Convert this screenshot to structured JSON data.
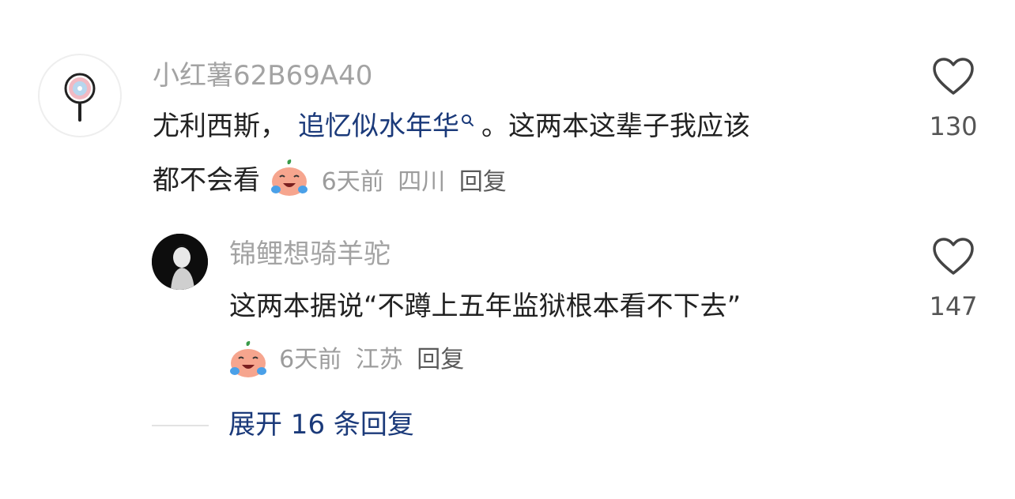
{
  "comment": {
    "username": "小红薯62B69A40",
    "text_prefix": "尤利西斯，",
    "link_text": "追忆似水年华",
    "text_suffix": "。这两本这辈子我应该",
    "text_line2": "都不会看",
    "time": "6天前",
    "location": "四川",
    "reply_label": "回复",
    "like_count": "130"
  },
  "reply": {
    "username": "锦鲤想骑羊驼",
    "text": "这两本据说“不蹲上五年监狱根本看不下去”",
    "time": "6天前",
    "location": "江苏",
    "reply_label": "回复",
    "like_count": "147"
  },
  "expand": {
    "label": "展开 16 条回复"
  },
  "icons": {
    "like": "heart-outline-icon",
    "search": "search-icon",
    "emoji": "crying-laughing-emoji"
  },
  "colors": {
    "link": "#1b3a7a",
    "username": "#a3a3a3",
    "body": "#222222"
  }
}
